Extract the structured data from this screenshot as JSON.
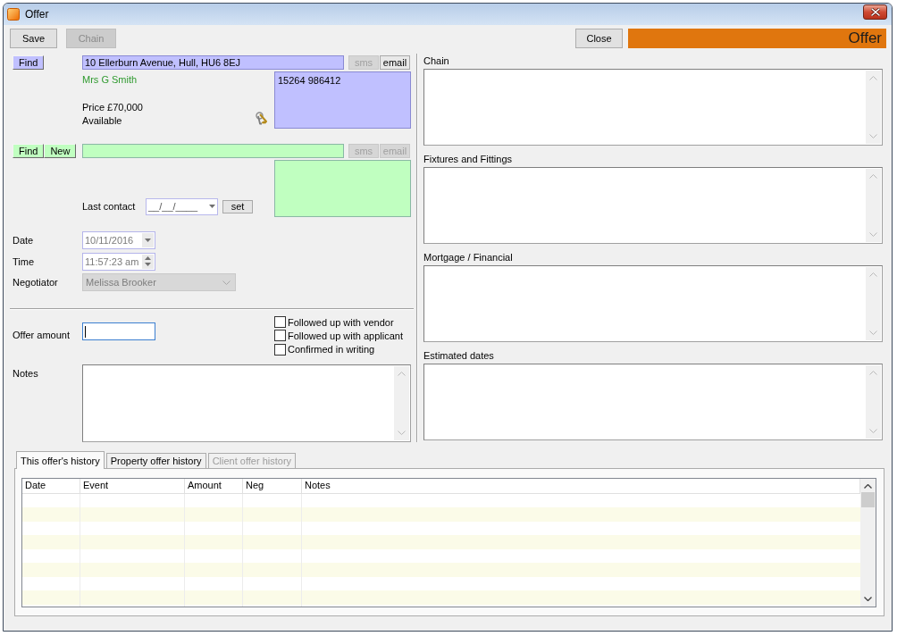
{
  "window": {
    "title": "Offer"
  },
  "toolbar": {
    "buttons": [
      {
        "label": "Save",
        "disabled": false
      },
      {
        "label": "Chain",
        "disabled": true
      }
    ],
    "close_button": {
      "label": "Close"
    },
    "banner": {
      "text": "Offer"
    }
  },
  "contacts": [
    {
      "kind": "property",
      "color": "#c0c0ff",
      "buttons": [
        {
          "label": "Find"
        }
      ],
      "address": {
        "value": "10 Ellerburn Avenue, Hull, HU6 8EJ"
      },
      "sms": {
        "label": "sms",
        "disabled": true
      },
      "email": {
        "label": "email",
        "disabled": false
      },
      "contact_box": {
        "value": "15264 986412"
      },
      "name": "Mrs G Smith",
      "details": [
        "Price £70,000",
        "Available"
      ]
    },
    {
      "kind": "applicant",
      "color": "#c0ffc0",
      "buttons": [
        {
          "label": "Find"
        },
        {
          "label": "New"
        }
      ],
      "sms": {
        "label": "sms",
        "disabled": true
      },
      "email": {
        "label": "email",
        "disabled": true
      },
      "last_contact": {
        "label": "Last contact",
        "value": "__/__/____",
        "button": "set"
      }
    }
  ],
  "fields": [
    {
      "kind": "date",
      "label": "Date",
      "value": "10/11/2016",
      "disabled": true
    },
    {
      "kind": "time",
      "label": "Time",
      "value": "11:57:23 am",
      "disabled": true
    },
    {
      "kind": "combo",
      "label": "Negotiator",
      "value": "Melissa Brooker",
      "disabled": true
    }
  ],
  "offer_amount": {
    "label": "Offer amount",
    "focused": true
  },
  "checkboxes": [
    {
      "label": "Followed up with vendor",
      "checked": false
    },
    {
      "label": "Followed up with applicant",
      "checked": false
    },
    {
      "label": "Confirmed in writing",
      "checked": false
    }
  ],
  "notes": {
    "label": "Notes"
  },
  "text_sections": [
    {
      "label": "Chain"
    },
    {
      "label": "Fixtures and Fittings"
    },
    {
      "label": "Mortgage / Financial"
    },
    {
      "label": "Estimated dates"
    }
  ],
  "history": {
    "tabs": [
      {
        "label": "This offer's history",
        "selected": true,
        "disabled": false
      },
      {
        "label": "Property offer history",
        "selected": false,
        "disabled": false
      },
      {
        "label": "Client offer history",
        "selected": false,
        "disabled": true
      }
    ],
    "table": {
      "columns": [
        "Date",
        "Event",
        "Amount",
        "Neg",
        "Notes"
      ]
    }
  }
}
